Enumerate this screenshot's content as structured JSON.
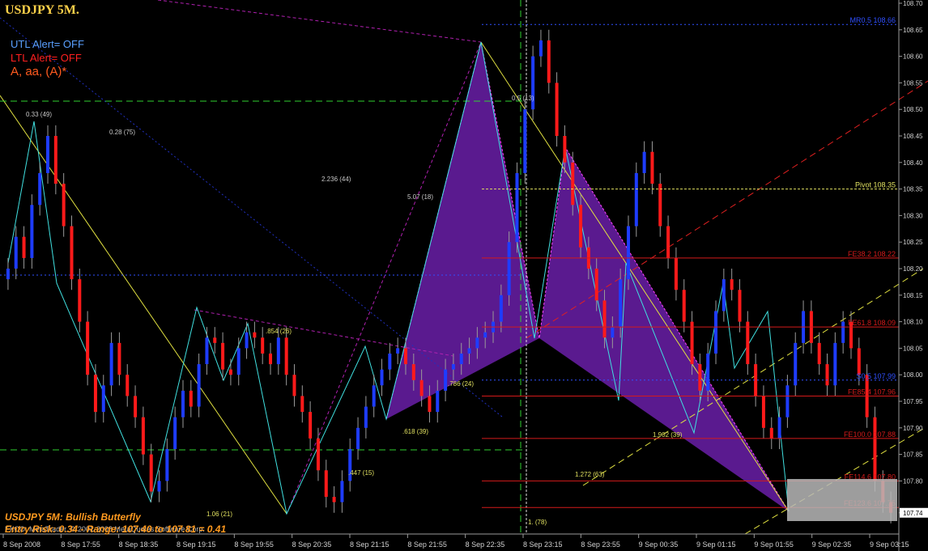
{
  "chart_title": "USDJPY 5M.",
  "alerts": {
    "utl": "UTL Alert= OFF",
    "ltl": "LTL Alert= OFF"
  },
  "pattern_labels": "A, aa, (A)*",
  "caption": {
    "line1": "USDJPY 5M: Bullish Butterfly",
    "line2": "Entry Risk: 0.34 - Range: 107.40 to 107.81 = 0.41"
  },
  "copyright": "FXCO, MetaTrader, © 2001-2008 MetaQuotes Software Corp.",
  "colors": {
    "background": "#000000",
    "bull_candle": "#1e3cff",
    "bear_candle": "#ff1a1a",
    "pattern_fill": "#6a1fa8",
    "grid": "#7a7a7a",
    "fib_line": "#d41a1a",
    "pivot_line": "#c8c8c8",
    "alert_utl": "#5aa0ff",
    "alert_ltl": "#ff2020",
    "current_price_bg": "#ffffff"
  },
  "chart_data": {
    "type": "candlestick",
    "symbol": "USDJPY",
    "timeframe": "5M",
    "ylim": [
      107.7,
      108.7
    ],
    "y_ticks": [
      "108.70",
      "108.65",
      "108.60",
      "108.55",
      "108.50",
      "108.45",
      "108.40",
      "108.35",
      "108.30",
      "108.25",
      "108.20",
      "108.15",
      "108.10",
      "108.05",
      "108.00",
      "107.95",
      "107.90",
      "107.85",
      "107.80",
      "107.74"
    ],
    "x_ticks": [
      "8 Sep 2008",
      "8 Sep 17:55",
      "8 Sep 18:35",
      "8 Sep 19:15",
      "8 Sep 19:55",
      "8 Sep 20:35",
      "8 Sep 21:15",
      "8 Sep 21:55",
      "8 Sep 22:35",
      "8 Sep 23:15",
      "8 Sep 23:55",
      "9 Sep 00:35",
      "9 Sep 01:15",
      "9 Sep 01:55",
      "9 Sep 02:35",
      "9 Sep 03:15"
    ],
    "current_price": "107.74",
    "closes": [
      108.2,
      108.26,
      108.22,
      108.32,
      108.38,
      108.45,
      108.36,
      108.28,
      108.18,
      108.1,
      108.0,
      107.93,
      107.98,
      108.06,
      108.0,
      107.96,
      107.92,
      107.85,
      107.78,
      107.8,
      107.86,
      107.92,
      107.97,
      107.94,
      108.02,
      108.07,
      108.06,
      108.01,
      108.0,
      108.05,
      108.08,
      108.07,
      108.04,
      108.02,
      108.07,
      108.0,
      107.96,
      107.93,
      107.88,
      107.82,
      107.77,
      107.76,
      107.8,
      107.86,
      107.9,
      107.94,
      107.98,
      108.01,
      108.04,
      108.05,
      108.02,
      107.99,
      107.96,
      107.93,
      107.97,
      108.01,
      108.02,
      108.04,
      108.05,
      108.07,
      108.08,
      108.1,
      108.15,
      108.25,
      108.38,
      108.5,
      108.6,
      108.63,
      108.55,
      108.45,
      108.4,
      108.32,
      108.24,
      108.2,
      108.14,
      108.07,
      108.09,
      108.18,
      108.28,
      108.38,
      108.42,
      108.36,
      108.28,
      108.22,
      108.16,
      108.1,
      108.02,
      107.97,
      108.04,
      108.12,
      108.18,
      108.16,
      108.1,
      108.02,
      107.96,
      107.9,
      107.88,
      107.92,
      107.98,
      108.06,
      108.12,
      108.06,
      108.02,
      107.98,
      108.06,
      108.1,
      108.05,
      108.0,
      107.92,
      107.8,
      107.76,
      107.74
    ],
    "fib_levels": [
      {
        "label": "FE38.2",
        "value": "108.22"
      },
      {
        "label": "FE61.8",
        "value": "108.09"
      },
      {
        "label": "FE85.4",
        "value": "107.96"
      },
      {
        "label": "FE100.0",
        "value": "107.88"
      },
      {
        "label": "FE114.6",
        "value": "107.80"
      },
      {
        "label": "FE123.6",
        "value": "107.75"
      }
    ],
    "pivot": {
      "label": "Pivot",
      "value": "108.35"
    },
    "mr_level": {
      "label": "MR0.5",
      "value": "108.66"
    },
    "s_level": {
      "label": "S0.5",
      "value": "107.99"
    },
    "pattern_ratios": [
      "0.33 (49)",
      "0.28 (75)",
      "2.236 (44)",
      "5.07 (18)",
      "0.5 (13)",
      ".854 (26)",
      ".786 (24)",
      ".618 (39)",
      ".447 (15)",
      "1.272 (63)",
      "1.902 (39)",
      "1.06 (21)",
      "1. (78)"
    ]
  }
}
